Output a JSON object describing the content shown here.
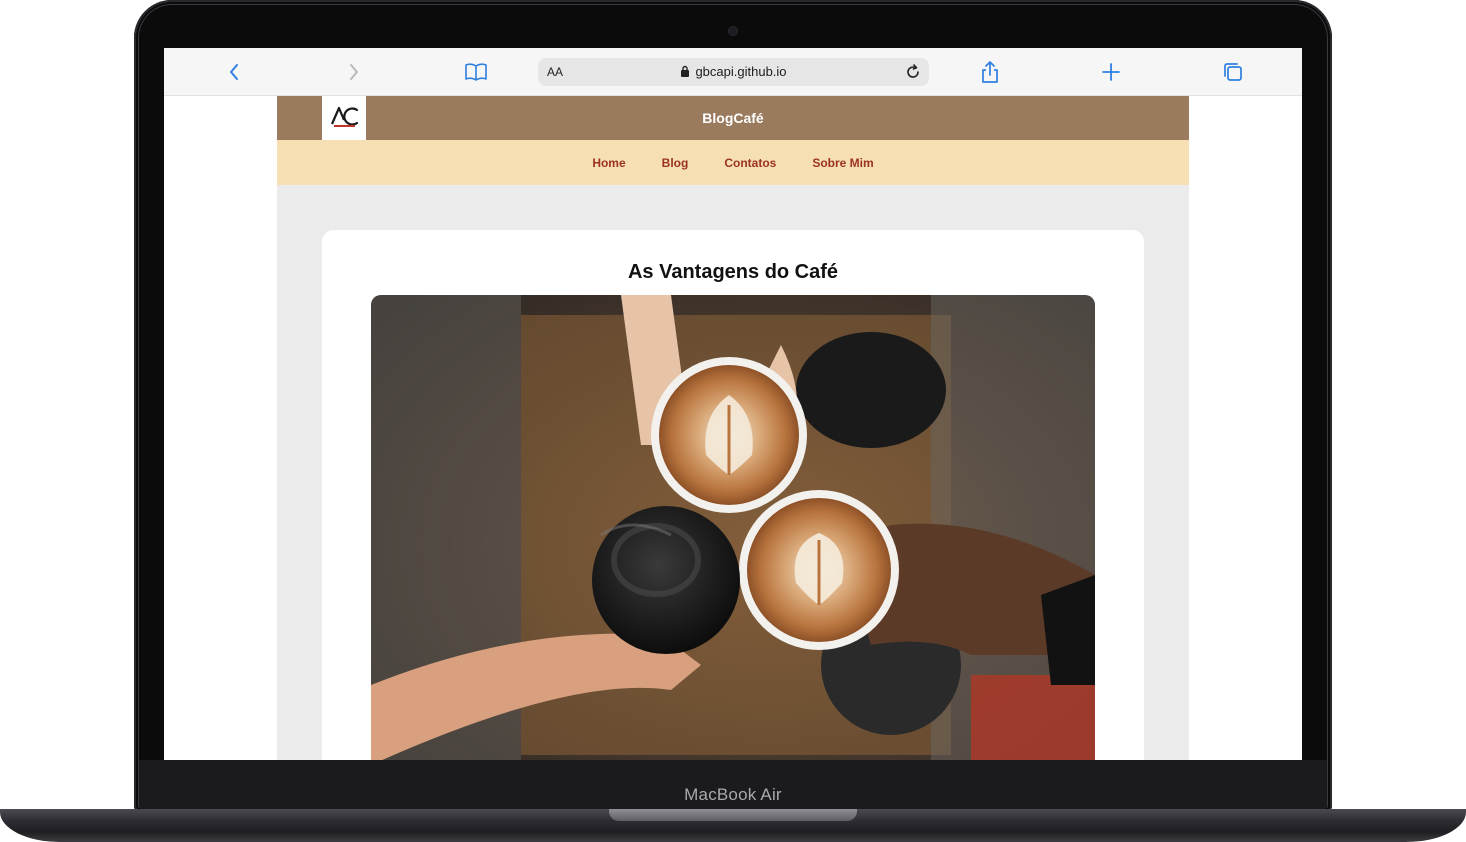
{
  "device": {
    "model_label": "MacBook Air"
  },
  "browser": {
    "address_bar": {
      "text_size_label": "AA",
      "url": "gbcapi.github.io"
    },
    "buttons": {
      "back": "back-icon",
      "forward": "forward-icon",
      "bookmarks": "book-icon",
      "reload": "reload-icon",
      "share": "share-icon",
      "new_tab": "plus-icon",
      "tabs": "tabs-icon"
    },
    "accent_color": "#2f7fe0"
  },
  "site": {
    "title": "BlogCafé",
    "header_color": "#9a7b5e",
    "nav_color": "#f6dfb2",
    "nav": [
      {
        "label": "Home"
      },
      {
        "label": "Blog"
      },
      {
        "label": "Contatos"
      },
      {
        "label": "Sobre Mim"
      }
    ]
  },
  "post": {
    "title": "As Vantagens do Café",
    "image": "coffee-cups-toast-photo"
  }
}
